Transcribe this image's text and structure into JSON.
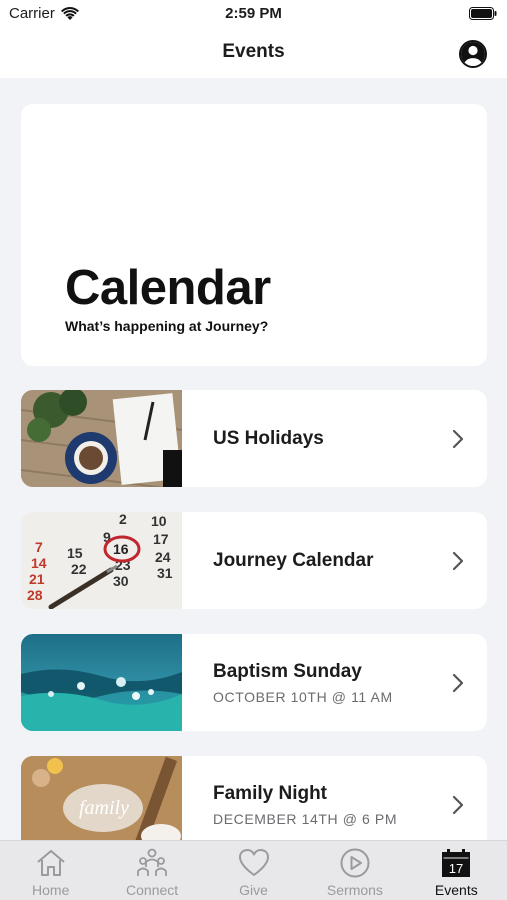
{
  "status_bar": {
    "carrier": "Carrier",
    "time": "2:59 PM"
  },
  "nav": {
    "title": "Events",
    "profile_icon": "person-circle-icon"
  },
  "hero": {
    "title": "Calendar",
    "subtitle": "What’s happening at Journey?"
  },
  "events": [
    {
      "title": "US Holidays",
      "subtitle": "",
      "thumb": "desk-coffee-notebook"
    },
    {
      "title": "Journey Calendar",
      "subtitle": "",
      "thumb": "calendar-page-circled-16"
    },
    {
      "title": "Baptism Sunday",
      "subtitle": "OCTOBER 10TH @ 11 AM",
      "thumb": "ocean-water"
    },
    {
      "title": "Family Night",
      "subtitle": "DECEMBER 14TH @ 6 PM",
      "thumb": "flour-family-baking"
    }
  ],
  "calendar_thumb_numbers": [
    "2",
    "10",
    "9",
    "17",
    "7",
    "14",
    "16",
    "24",
    "21",
    "15",
    "23",
    "31",
    "28",
    "22",
    "30"
  ],
  "tabs": [
    {
      "label": "Home",
      "icon": "home-icon",
      "active": false
    },
    {
      "label": "Connect",
      "icon": "people-icon",
      "active": false
    },
    {
      "label": "Give",
      "icon": "heart-icon",
      "active": false
    },
    {
      "label": "Sermons",
      "icon": "play-circle-icon",
      "active": false
    },
    {
      "label": "Events",
      "icon": "calendar-icon",
      "active": true,
      "badge": "17"
    }
  ],
  "colors": {
    "background": "#f2f3f6",
    "card": "#ffffff",
    "tab_bar": "#e8e8ea",
    "inactive_tab": "#9a9a9f",
    "active_tab": "#111111"
  }
}
